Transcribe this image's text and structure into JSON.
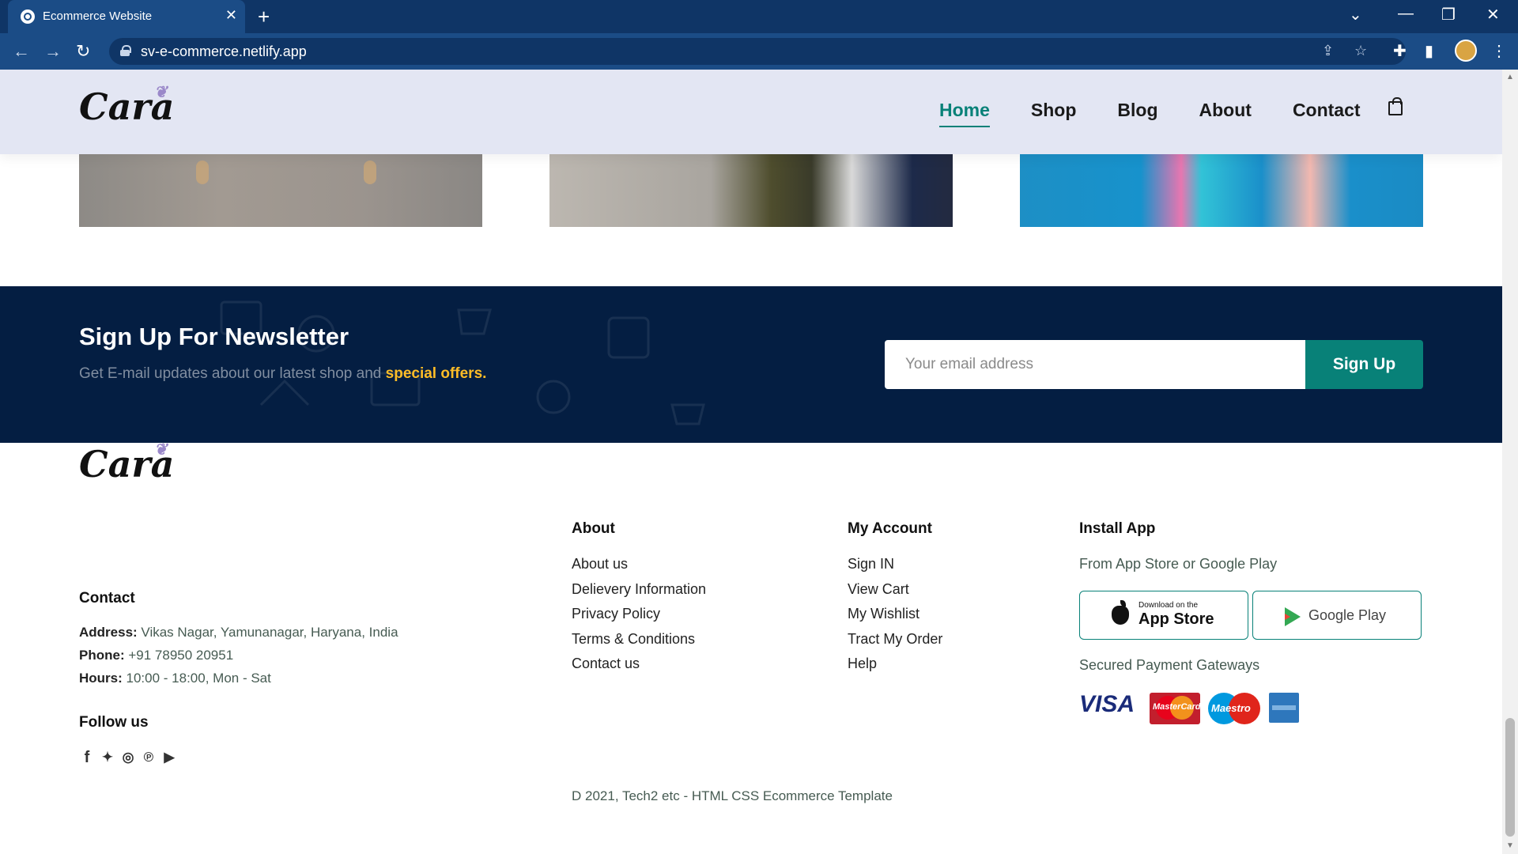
{
  "browser": {
    "tab_title": "Ecommerce Website",
    "tab_close": "✕",
    "new_tab": "+",
    "url": "sv-e-commerce.netlify.app",
    "window_controls": [
      "⌄",
      "—",
      "❐",
      "✕"
    ]
  },
  "header": {
    "logo": "Cara",
    "nav": [
      {
        "label": "Home",
        "active": true
      },
      {
        "label": "Shop",
        "active": false
      },
      {
        "label": "Blog",
        "active": false
      },
      {
        "label": "About",
        "active": false
      },
      {
        "label": "Contact",
        "active": false
      }
    ]
  },
  "newsletter": {
    "title": "Sign Up For Newsletter",
    "subtitle_prefix": "Get E-mail updates about our latest shop and ",
    "subtitle_highlight": "special offers.",
    "email_placeholder": "Your email address",
    "button_label": "Sign Up"
  },
  "footer": {
    "logo": "Cara",
    "contact_title": "Contact",
    "address_label": "Address:",
    "address_value": "Vikas Nagar, Yamunanagar, Haryana, India",
    "phone_label": "Phone:",
    "phone_value": "+91 78950 20951",
    "hours_label": "Hours:",
    "hours_value": "10:00 - 18:00, Mon - Sat",
    "follow_title": "Follow us",
    "about_title": "About",
    "about_links": [
      "About us",
      "Delievery Information",
      "Privacy Policy",
      "Terms & Conditions",
      "Contact us"
    ],
    "account_title": "My Account",
    "account_links": [
      "Sign IN",
      "View Cart",
      "My Wishlist",
      "Tract My Order",
      "Help"
    ],
    "install_title": "Install App",
    "install_sub": "From App Store or Google Play",
    "appstore_small": "Download on the",
    "appstore_big": "App Store",
    "googleplay": "Google Play",
    "payments_title": "Secured Payment Gateways",
    "visa": "VISA",
    "mastercard": "MasterCard",
    "maestro": "Maestro",
    "copyright": "D 2021, Tech2 etc - HTML CSS Ecommerce Template"
  },
  "colors": {
    "accent": "#088178",
    "newsletter_bg": "#041e42",
    "highlight": "#ffbd27",
    "header_bg": "#e3e6f3"
  }
}
